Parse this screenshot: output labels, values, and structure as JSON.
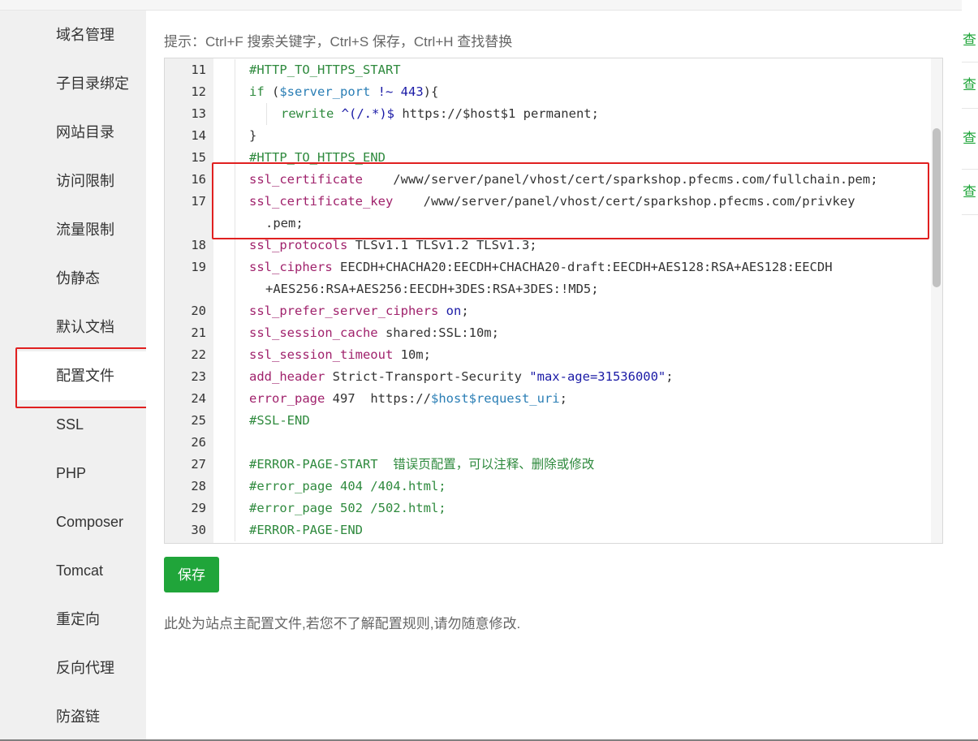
{
  "tip": "提示：Ctrl+F 搜索关键字，Ctrl+S 保存，Ctrl+H 查找替换",
  "sidebar": {
    "items": [
      {
        "label": "域名管理"
      },
      {
        "label": "子目录绑定"
      },
      {
        "label": "网站目录"
      },
      {
        "label": "访问限制"
      },
      {
        "label": "流量限制"
      },
      {
        "label": "伪静态"
      },
      {
        "label": "默认文档"
      },
      {
        "label": "配置文件",
        "active": true
      },
      {
        "label": "SSL"
      },
      {
        "label": "PHP"
      },
      {
        "label": "Composer"
      },
      {
        "label": "Tomcat"
      },
      {
        "label": "重定向"
      },
      {
        "label": "反向代理"
      },
      {
        "label": "防盗链"
      }
    ]
  },
  "editor": {
    "lines": [
      {
        "num": "11",
        "indent": 0,
        "segments": [
          {
            "t": "#HTTP_TO_HTTPS_START",
            "c": "cm"
          }
        ]
      },
      {
        "num": "12",
        "indent": 0,
        "segments": [
          {
            "t": "if",
            "c": "kw"
          },
          {
            "t": " (",
            "c": "plain"
          },
          {
            "t": "$server_port",
            "c": "var"
          },
          {
            "t": " !~ ",
            "c": "str"
          },
          {
            "t": "443",
            "c": "str"
          },
          {
            "t": "){",
            "c": "plain"
          }
        ]
      },
      {
        "num": "13",
        "indent": 1,
        "segments": [
          {
            "t": "rewrite",
            "c": "kw"
          },
          {
            "t": " ^(/.*)$",
            "c": "str"
          },
          {
            "t": " https://$host$1 permanent;",
            "c": "plain"
          }
        ]
      },
      {
        "num": "14",
        "indent": 0,
        "segments": [
          {
            "t": "}",
            "c": "plain"
          }
        ]
      },
      {
        "num": "15",
        "indent": 0,
        "segments": [
          {
            "t": "#HTTP_TO_HTTPS_END",
            "c": "cm"
          }
        ]
      },
      {
        "num": "16",
        "indent": 0,
        "segments": [
          {
            "t": "ssl_certificate",
            "c": "red"
          },
          {
            "t": "    /www/server/panel/vhost/cert/sparkshop.pfecms.com/fullchain.pem;",
            "c": "plain"
          }
        ]
      },
      {
        "num": "17",
        "indent": 0,
        "segments": [
          {
            "t": "ssl_certificate_key",
            "c": "red"
          },
          {
            "t": "    /www/server/panel/vhost/cert/sparkshop.pfecms.com/privkey",
            "c": "plain"
          }
        ]
      },
      {
        "num": "",
        "indent": 0,
        "wrap": true,
        "segments": [
          {
            "t": ".pem;",
            "c": "plain"
          }
        ]
      },
      {
        "num": "18",
        "indent": 0,
        "segments": [
          {
            "t": "ssl_protocols",
            "c": "red"
          },
          {
            "t": " TLSv1.1 TLSv1.2 TLSv1.3;",
            "c": "plain"
          }
        ]
      },
      {
        "num": "19",
        "indent": 0,
        "segments": [
          {
            "t": "ssl_ciphers",
            "c": "red"
          },
          {
            "t": " EECDH+CHACHA20:EECDH+CHACHA20-draft:EECDH+AES128:RSA+AES128:EECDH",
            "c": "plain"
          }
        ]
      },
      {
        "num": "",
        "indent": 0,
        "wrap": true,
        "segments": [
          {
            "t": "+AES256:RSA+AES256:EECDH+3DES:RSA+3DES:!MD5;",
            "c": "plain"
          }
        ]
      },
      {
        "num": "20",
        "indent": 0,
        "segments": [
          {
            "t": "ssl_prefer_server_ciphers",
            "c": "red"
          },
          {
            "t": " ",
            "c": "plain"
          },
          {
            "t": "on",
            "c": "str"
          },
          {
            "t": ";",
            "c": "plain"
          }
        ]
      },
      {
        "num": "21",
        "indent": 0,
        "segments": [
          {
            "t": "ssl_session_cache",
            "c": "red"
          },
          {
            "t": " shared:SSL:10m;",
            "c": "plain"
          }
        ]
      },
      {
        "num": "22",
        "indent": 0,
        "segments": [
          {
            "t": "ssl_session_timeout",
            "c": "red"
          },
          {
            "t": " 10m;",
            "c": "plain"
          }
        ]
      },
      {
        "num": "23",
        "indent": 0,
        "segments": [
          {
            "t": "add_header",
            "c": "red"
          },
          {
            "t": " Strict-Transport-Security ",
            "c": "plain"
          },
          {
            "t": "\"max-age=31536000\"",
            "c": "str"
          },
          {
            "t": ";",
            "c": "plain"
          }
        ]
      },
      {
        "num": "24",
        "indent": 0,
        "segments": [
          {
            "t": "error_page",
            "c": "red"
          },
          {
            "t": " 497  https://",
            "c": "plain"
          },
          {
            "t": "$host$request_uri",
            "c": "var"
          },
          {
            "t": ";",
            "c": "plain"
          }
        ]
      },
      {
        "num": "25",
        "indent": 0,
        "segments": [
          {
            "t": "#SSL-END",
            "c": "cm"
          }
        ]
      },
      {
        "num": "26",
        "indent": 0,
        "segments": []
      },
      {
        "num": "27",
        "indent": 0,
        "segments": [
          {
            "t": "#ERROR-PAGE-START  错误页配置，可以注释、删除或修改",
            "c": "cm"
          }
        ]
      },
      {
        "num": "28",
        "indent": 0,
        "segments": [
          {
            "t": "#error_page 404 /404.html;",
            "c": "cm"
          }
        ]
      },
      {
        "num": "29",
        "indent": 0,
        "segments": [
          {
            "t": "#error_page 502 /502.html;",
            "c": "cm"
          }
        ]
      },
      {
        "num": "30",
        "indent": 0,
        "segments": [
          {
            "t": "#ERROR-PAGE-END",
            "c": "cm"
          }
        ]
      }
    ]
  },
  "save_label": "保存",
  "note": "此处为站点主配置文件,若您不了解配置规则,请勿随意修改.",
  "background_links": [
    "查",
    "查",
    "查",
    "查"
  ],
  "colors": {
    "accent": "#20a53a",
    "highlight": "#e02020"
  }
}
